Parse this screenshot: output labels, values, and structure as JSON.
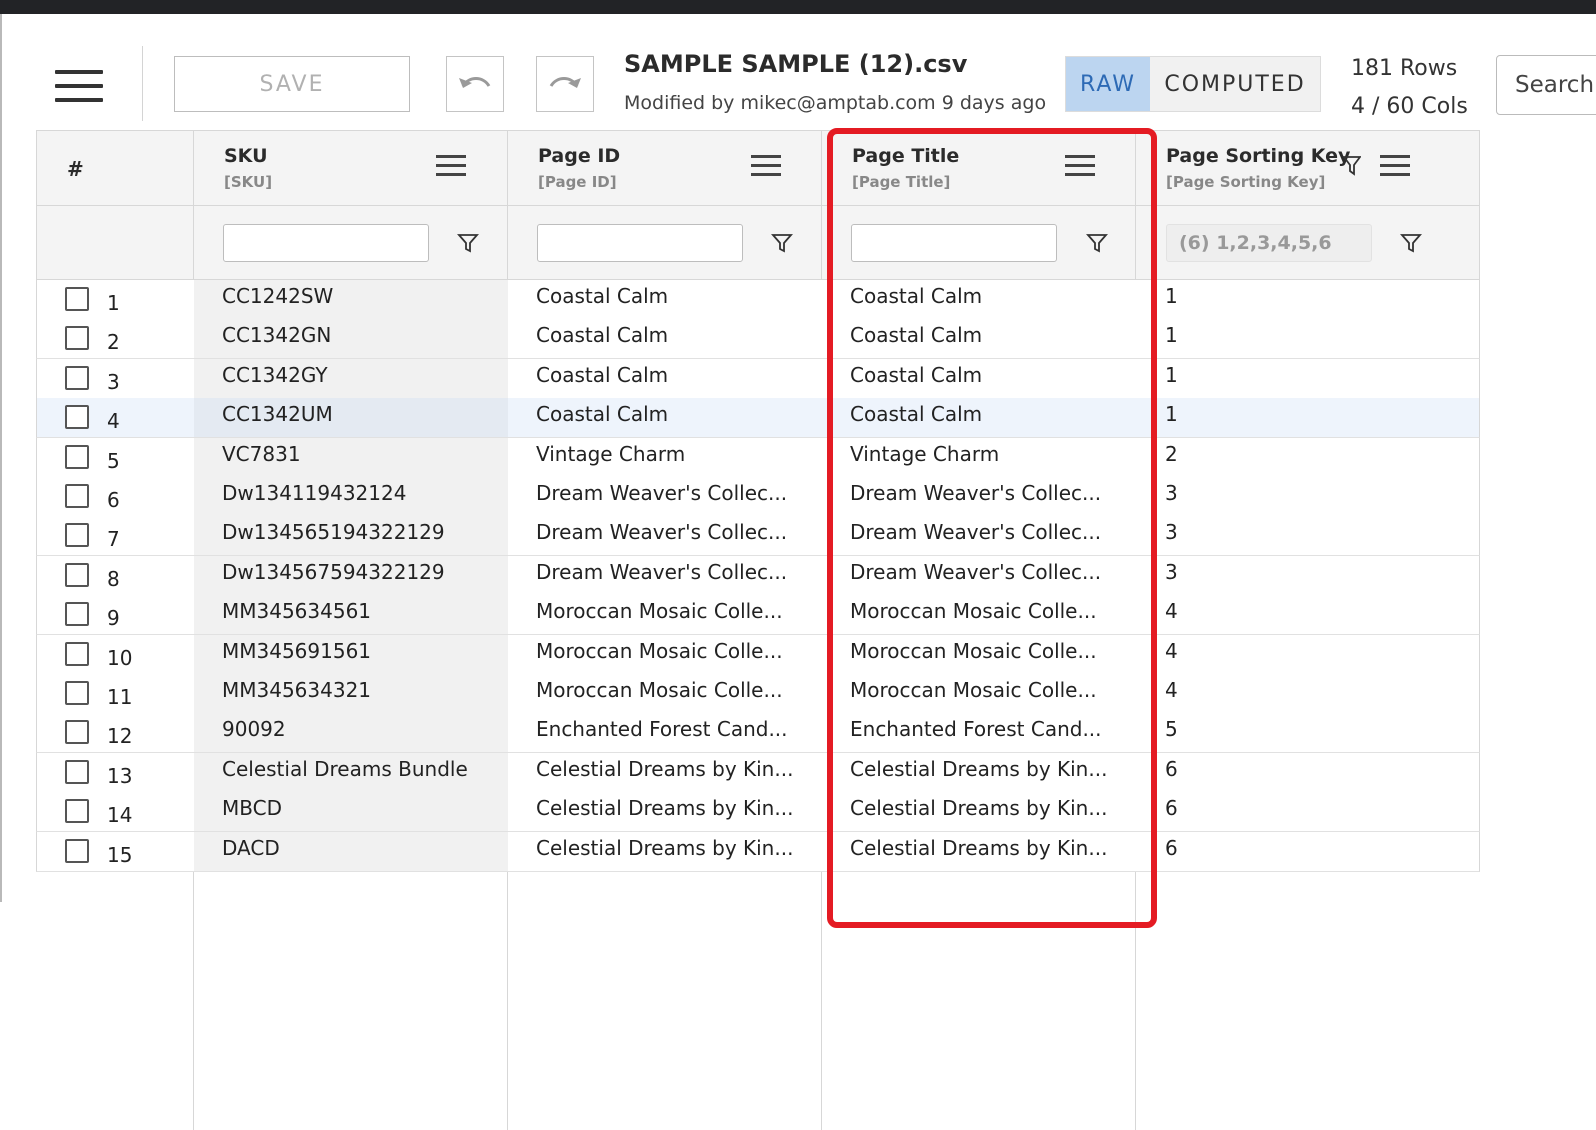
{
  "toolbar": {
    "save_label": "SAVE",
    "file_name": "SAMPLE SAMPLE (12).csv",
    "modified_text": "Modified by mikec@amptab.com 9 days ago",
    "raw_label": "RAW",
    "computed_label": "COMPUTED",
    "rows_text": "181 Rows",
    "cols_text": "4 / 60 Cols",
    "search_label": "Search"
  },
  "grid": {
    "index_header": "#",
    "columns": [
      {
        "name": "SKU",
        "sub": "[SKU]",
        "filter_value": "",
        "filter_placeholder": ""
      },
      {
        "name": "Page ID",
        "sub": "[Page ID]",
        "filter_value": "",
        "filter_placeholder": ""
      },
      {
        "name": "Page Title",
        "sub": "[Page Title]",
        "filter_value": "",
        "filter_placeholder": ""
      },
      {
        "name": "Page Sorting Key",
        "sub": "[Page Sorting Key]",
        "filter_value": "(6) 1,2,3,4,5,6",
        "filter_placeholder": ""
      }
    ],
    "rows": [
      {
        "n": "1",
        "sku": "CC1242SW",
        "page_id": "Coastal Calm",
        "page_title": "Coastal Calm",
        "key": "1"
      },
      {
        "n": "2",
        "sku": "CC1342GN",
        "page_id": "Coastal Calm",
        "page_title": "Coastal Calm",
        "key": "1"
      },
      {
        "n": "3",
        "sku": "CC1342GY",
        "page_id": "Coastal Calm",
        "page_title": "Coastal Calm",
        "key": "1"
      },
      {
        "n": "4",
        "sku": "CC1342UM",
        "page_id": "Coastal Calm",
        "page_title": "Coastal Calm",
        "key": "1"
      },
      {
        "n": "5",
        "sku": "VC7831",
        "page_id": "Vintage Charm",
        "page_title": "Vintage Charm",
        "key": "2"
      },
      {
        "n": "6",
        "sku": "Dw134119432124",
        "page_id": "Dream Weaver's Collec...",
        "page_title": "Dream Weaver's Collec...",
        "key": "3"
      },
      {
        "n": "7",
        "sku": "Dw134565194322129",
        "page_id": "Dream Weaver's Collec...",
        "page_title": "Dream Weaver's Collec...",
        "key": "3"
      },
      {
        "n": "8",
        "sku": "Dw134567594322129",
        "page_id": "Dream Weaver's Collec...",
        "page_title": "Dream Weaver's Collec...",
        "key": "3"
      },
      {
        "n": "9",
        "sku": "MM345634561",
        "page_id": "Moroccan Mosaic Colle...",
        "page_title": "Moroccan Mosaic Colle...",
        "key": "4"
      },
      {
        "n": "10",
        "sku": "MM345691561",
        "page_id": "Moroccan Mosaic Colle...",
        "page_title": "Moroccan Mosaic Colle...",
        "key": "4"
      },
      {
        "n": "11",
        "sku": "MM345634321",
        "page_id": "Moroccan Mosaic Colle...",
        "page_title": "Moroccan Mosaic Colle...",
        "key": "4"
      },
      {
        "n": "12",
        "sku": "90092",
        "page_id": "Enchanted Forest Cand...",
        "page_title": "Enchanted Forest Cand...",
        "key": "5"
      },
      {
        "n": "13",
        "sku": "Celestial Dreams Bundle",
        "page_id": "Celestial Dreams by Kin...",
        "page_title": "Celestial Dreams by Kin...",
        "key": "6"
      },
      {
        "n": "14",
        "sku": "MBCD",
        "page_id": "Celestial Dreams by Kin...",
        "page_title": "Celestial Dreams by Kin...",
        "key": "6"
      },
      {
        "n": "15",
        "sku": "DACD",
        "page_id": "Celestial Dreams by Kin...",
        "page_title": "Celestial Dreams by Kin...",
        "key": "6"
      }
    ]
  },
  "colors": {
    "highlight": "#e41b23",
    "raw_active_bg": "#bcd5f0",
    "raw_active_text": "#2d6ab5"
  },
  "icons": {
    "menu": "hamburger-icon",
    "undo": "undo-icon",
    "redo": "redo-icon",
    "filter": "filter-funnel-icon",
    "column_menu": "column-menu-icon"
  }
}
